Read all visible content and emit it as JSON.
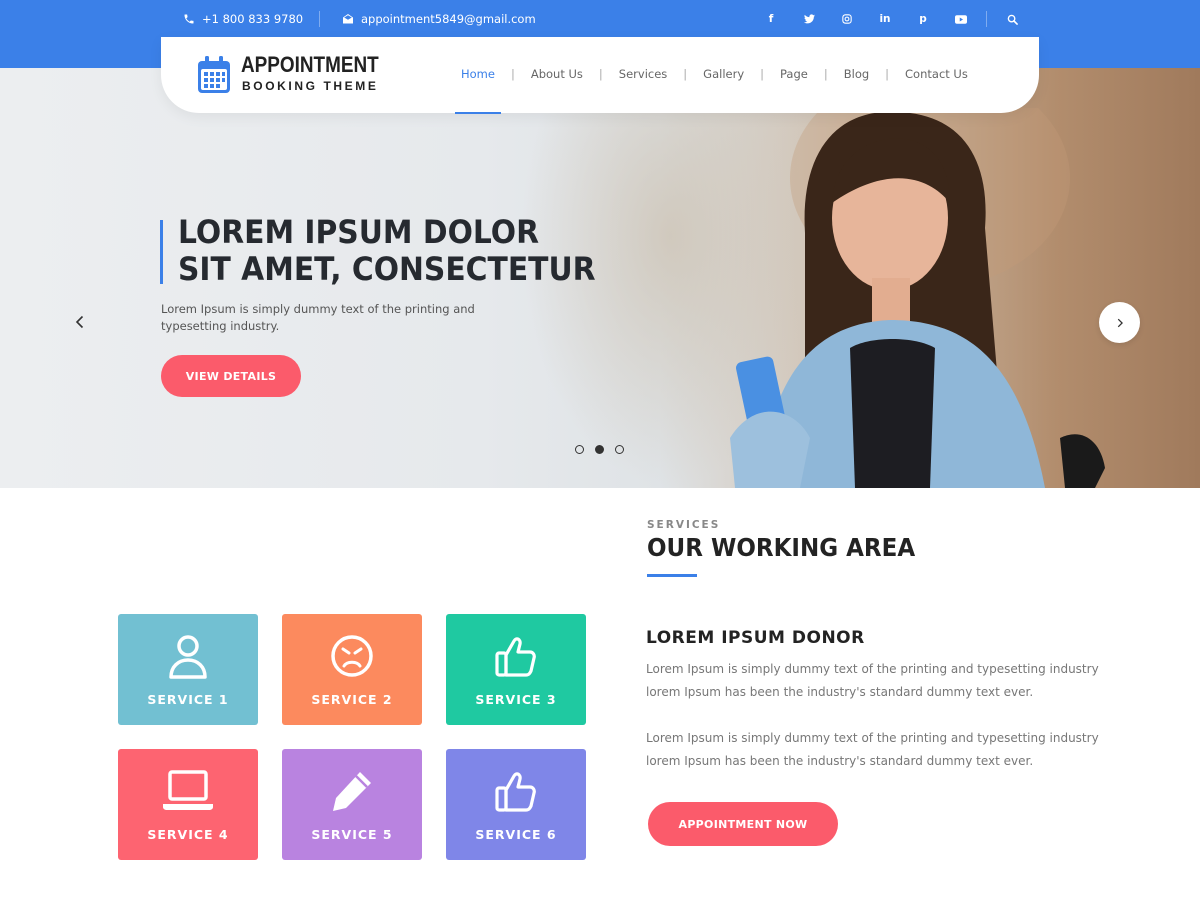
{
  "topbar": {
    "phone": "+1 800 833 9780",
    "email": "appointment5849@gmail.com",
    "social": [
      {
        "icon": "facebook-icon",
        "glyph": "f"
      },
      {
        "icon": "twitter-icon",
        "glyph": "t"
      },
      {
        "icon": "instagram-icon",
        "glyph": "◎"
      },
      {
        "icon": "linkedin-icon",
        "glyph": "in"
      },
      {
        "icon": "pinterest-icon",
        "glyph": "p"
      },
      {
        "icon": "youtube-icon",
        "glyph": "▶"
      }
    ],
    "search_icon": "search-icon"
  },
  "logo": {
    "title": "APPOINTMENT",
    "subtitle": "BOOKING THEME"
  },
  "nav": {
    "items": [
      {
        "label": "Home",
        "active": true
      },
      {
        "label": "About Us",
        "active": false
      },
      {
        "label": "Services",
        "active": false
      },
      {
        "label": "Gallery",
        "active": false
      },
      {
        "label": "Page",
        "active": false
      },
      {
        "label": "Blog",
        "active": false
      },
      {
        "label": "Contact Us",
        "active": false
      }
    ]
  },
  "hero": {
    "title_line1": "LOREM IPSUM DOLOR",
    "title_line2": "SIT AMET, CONSECTETUR",
    "text": "Lorem Ipsum is simply dummy text of the printing and typesetting industry.",
    "button": "VIEW DETAILS",
    "slides": 3,
    "active_slide": 2
  },
  "services": {
    "label": "SERVICES",
    "heading": "OUR WORKING AREA",
    "tiles": [
      {
        "label": "SERVICE 1",
        "color": "#72c0d2",
        "icon": "user-icon"
      },
      {
        "label": "SERVICE 2",
        "color": "#fc8a5e",
        "icon": "angry-face-icon"
      },
      {
        "label": "SERVICE 3",
        "color": "#1fc9a1",
        "icon": "thumbs-up-icon"
      },
      {
        "label": "SERVICE 4",
        "color": "#fd6471",
        "icon": "laptop-icon"
      },
      {
        "label": "SERVICE 5",
        "color": "#b983e0",
        "icon": "pencil-icon"
      },
      {
        "label": "SERVICE 6",
        "color": "#7f86e8",
        "icon": "thumbs-up-icon"
      }
    ],
    "subheading": "LOREM IPSUM DONOR",
    "paragraph1": "Lorem Ipsum is simply dummy text of the printing and typesetting industry lorem Ipsum has been the industry's standard dummy text ever.",
    "paragraph2": "Lorem Ipsum is simply dummy text of the printing and typesetting industry lorem Ipsum has been the industry's standard dummy text ever.",
    "button": "APPOINTMENT NOW"
  },
  "colors": {
    "primary": "#3b80e8",
    "accent": "#fb5b6b"
  }
}
